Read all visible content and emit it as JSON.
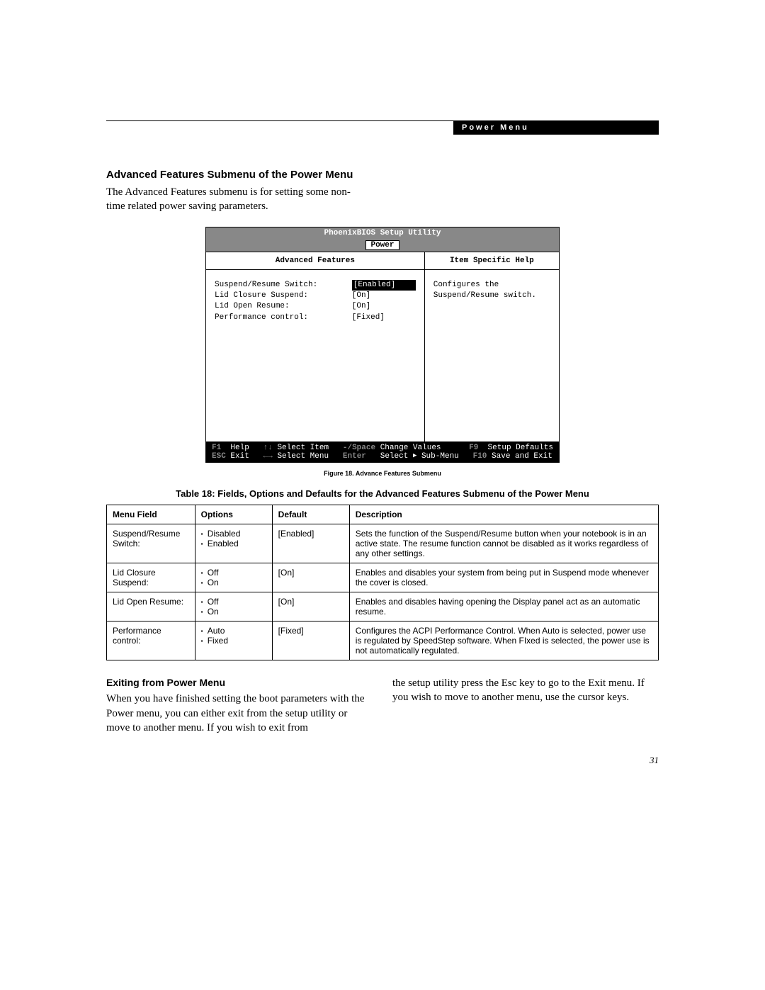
{
  "header": {
    "label": "Power Menu"
  },
  "section": {
    "title": "Advanced Features Submenu of the Power Menu",
    "intro": "The Advanced Features submenu is for setting some non-time related power saving parameters."
  },
  "bios": {
    "app_title": "PhoenixBIOS Setup Utility",
    "tab": "Power",
    "left_head": "Advanced Features",
    "right_head": "Item Specific Help",
    "settings": [
      {
        "label": "Suspend/Resume Switch:",
        "value": "[Enabled]",
        "highlight": true
      },
      {
        "label": "Lid Closure Suspend:",
        "value": "[On]",
        "highlight": false
      },
      {
        "label": "Lid Open Resume:",
        "value": "[On]",
        "highlight": false
      },
      {
        "label": "Performance control:",
        "value": "[Fixed]",
        "highlight": false
      }
    ],
    "help_text": "Configures the Suspend/Resume switch.",
    "footer": {
      "line1": {
        "k1": "F1",
        "t1": "Help",
        "k2": "↑↓",
        "t2": "Select Item",
        "k3": "-/Space",
        "t3": "Change Values",
        "k4": "F9",
        "t4": "Setup Defaults"
      },
      "line2": {
        "k1": "ESC",
        "t1": "Exit",
        "k2": "←→",
        "t2": "Select Menu",
        "k3": "Enter",
        "t3_a": "Select ",
        "t3_b": " Sub-Menu",
        "k4": "F10",
        "t4": "Save and Exit"
      }
    }
  },
  "figure_caption": "Figure 18.  Advance Features Submenu",
  "table_title": "Table 18: Fields, Options and Defaults for the Advanced Features Submenu of the Power Menu",
  "table": {
    "headers": {
      "menu": "Menu Field",
      "options": "Options",
      "def": "Default",
      "desc": "Description"
    },
    "rows": [
      {
        "menu": "Suspend/Resume Switch:",
        "options": [
          "Disabled",
          "Enabled"
        ],
        "def": "[Enabled]",
        "desc": "Sets the function of the Suspend/Resume button when your notebook is in an active state. The resume function cannot be disabled as it works regardless of any other settings."
      },
      {
        "menu": "Lid Closure Suspend:",
        "options": [
          "Off",
          "On"
        ],
        "def": "[On]",
        "desc": "Enables and disables your system from being put in Suspend mode whenever the cover is closed."
      },
      {
        "menu": "Lid Open Resume:",
        "options": [
          "Off",
          "On"
        ],
        "def": "[On]",
        "desc": "Enables and disables having opening the Display panel act as an automatic resume."
      },
      {
        "menu": "Performance control:",
        "options": [
          "Auto",
          "Fixed"
        ],
        "def": "[Fixed]",
        "desc": "Configures the ACPI Performance Control. When Auto is selected, power use is regulated by SpeedStep software. When FIxed is selected, the power use is not automatically regulated."
      }
    ]
  },
  "exit": {
    "heading": "Exiting from Power Menu",
    "col1": "When you have finished setting the boot parameters with the Power menu, you can either exit from the setup utility or move to another menu. If you wish to exit from",
    "col2": "the setup utility press the Esc key to go to the Exit menu. If you wish to move to another menu, use the cursor keys."
  },
  "page_number": "31"
}
